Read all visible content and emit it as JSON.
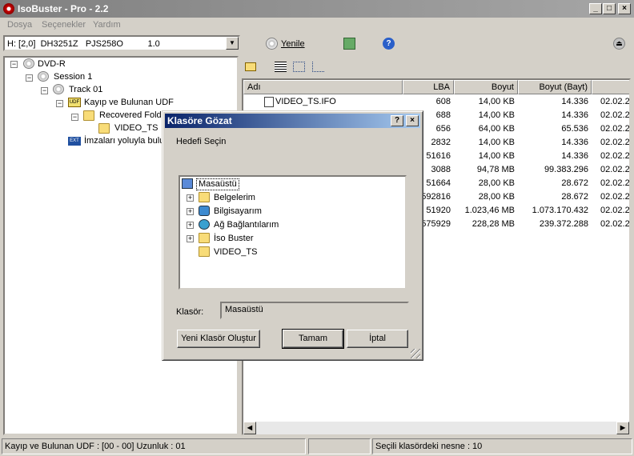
{
  "window": {
    "title": "IsoBuster - Pro - 2.2"
  },
  "menu": [
    "Dosya",
    "Seçenekler",
    "Yardım"
  ],
  "toolbar": {
    "drive": "H: [2,0]  DH3251Z   PJS258O          1.0",
    "refresh_label": "Yenile"
  },
  "tree": [
    {
      "label": "DVD-R"
    },
    {
      "label": "Session 1"
    },
    {
      "label": "Track 01"
    },
    {
      "label": "Kayıp ve Bulunan UDF"
    },
    {
      "label": "Recovered Folde"
    },
    {
      "label": "VIDEO_TS"
    },
    {
      "label": "İmzaları yoluyla bulu"
    }
  ],
  "list": {
    "headers": [
      "Adı",
      "LBA",
      "Boyut",
      "Boyut (Bayt)",
      ""
    ],
    "rows": [
      {
        "name": "VIDEO_TS.IFO",
        "lba": "608",
        "size": "14,00 KB",
        "bytes": "14.336",
        "date": "02.02.2"
      },
      {
        "name": "",
        "lba": "688",
        "size": "14,00 KB",
        "bytes": "14.336",
        "date": "02.02.2"
      },
      {
        "name": "",
        "lba": "656",
        "size": "64,00 KB",
        "bytes": "65.536",
        "date": "02.02.2"
      },
      {
        "name": "",
        "lba": "2832",
        "size": "14,00 KB",
        "bytes": "14.336",
        "date": "02.02.2"
      },
      {
        "name": "",
        "lba": "51616",
        "size": "14,00 KB",
        "bytes": "14.336",
        "date": "02.02.2"
      },
      {
        "name": "",
        "lba": "3088",
        "size": "94,78 MB",
        "bytes": "99.383.296",
        "date": "02.02.2"
      },
      {
        "name": "",
        "lba": "51664",
        "size": "28,00 KB",
        "bytes": "28.672",
        "date": "02.02.2"
      },
      {
        "name": "",
        "lba": "592816",
        "size": "28,00 KB",
        "bytes": "28.672",
        "date": "02.02.2"
      },
      {
        "name": "",
        "lba": "51920",
        "size": "1.023,46 MB",
        "bytes": "1.073.170.432",
        "date": "02.02.2"
      },
      {
        "name": "",
        "lba": "575929",
        "size": "228,28 MB",
        "bytes": "239.372.288",
        "date": "02.02.2"
      }
    ]
  },
  "statusbar": {
    "left": "Kayıp ve Bulunan UDF : [00 - 00]  Uzunluk : 01",
    "mid": "",
    "right": "Seçili klasördeki nesne : 10"
  },
  "dialog": {
    "title": "Klasöre Gözat",
    "help": "?",
    "close": "×",
    "prompt": "Hedefi Seçin",
    "root": "Masaüstü",
    "items": [
      "Belgelerim",
      "Bilgisayarım",
      "Ağ Bağlantılarım",
      "İso Buster",
      "VIDEO_TS"
    ],
    "folder_label": "Klasör:",
    "folder_value": "Masaüstü",
    "new_folder": "Yeni Klasör Oluştur",
    "ok": "Tamam",
    "cancel": "İptal"
  }
}
